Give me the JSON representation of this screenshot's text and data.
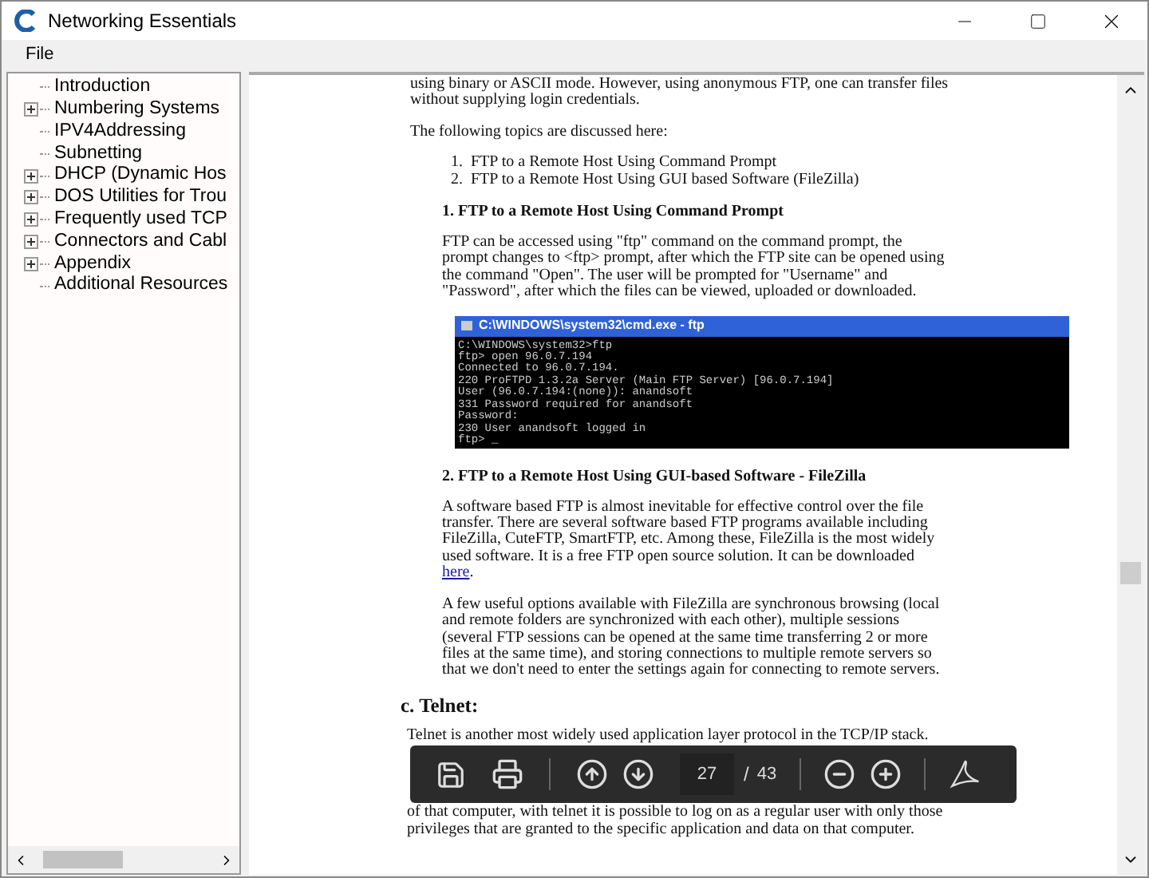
{
  "window": {
    "title": "Networking Essentials"
  },
  "menu": [
    "File"
  ],
  "tree": [
    {
      "label": "Introduction",
      "expandable": false
    },
    {
      "label": "Numbering Systems",
      "expandable": true
    },
    {
      "label": "IPV4Addressing",
      "expandable": false
    },
    {
      "label": "Subnetting",
      "expandable": false
    },
    {
      "label": "DHCP (Dynamic Hos",
      "expandable": true
    },
    {
      "label": "DOS Utilities for Trou",
      "expandable": true
    },
    {
      "label": "Frequently used TCP",
      "expandable": true
    },
    {
      "label": "Connectors and Cabl",
      "expandable": true
    },
    {
      "label": "Appendix",
      "expandable": true
    },
    {
      "label": "Additional Resources",
      "expandable": false
    }
  ],
  "document": [
    {
      "kind": "para",
      "indent": false,
      "text": "using binary or ASCII mode. However, using anonymous FTP, one can transfer files without supplying login credentials."
    },
    {
      "kind": "para",
      "indent": false,
      "text": "The following topics are discussed here:"
    },
    {
      "kind": "list",
      "items": [
        {
          "number": "1.",
          "text": "FTP to a Remote Host Using Command Prompt"
        },
        {
          "number": "2.",
          "text": "FTP to a Remote Host Using GUI based Software (FileZilla)"
        }
      ]
    },
    {
      "kind": "heading",
      "text": "1. FTP to a Remote Host Using Command Prompt"
    },
    {
      "kind": "para",
      "indent": true,
      "text": "FTP can be accessed using \"ftp\" command on the command prompt,  the prompt changes to <ftp> prompt, after which the FTP site can be opened using the command \"Open\". The user will be prompted  for \"Username\" and \"Password\", after which the files can be viewed, uploaded or downloaded."
    },
    {
      "kind": "console",
      "title": "C:\\WINDOWS\\system32\\cmd.exe - ftp",
      "lines": [
        "C:\\WINDOWS\\system32>ftp",
        "ftp> open 96.0.7.194",
        "Connected to 96.0.7.194.",
        "220 ProFTPD 1.3.2a Server (Main FTP Server) [96.0.7.194]",
        "User (96.0.7.194:(none)): anandsoft",
        "331 Password required for anandsoft",
        "Password:",
        "230 User anandsoft logged in",
        "ftp> _"
      ]
    },
    {
      "kind": "heading",
      "text": "2. FTP to a Remote Host Using GUI-based Software - FileZilla"
    },
    {
      "kind": "para",
      "indent": true,
      "text": "A software based FTP is almost inevitable for effective control over the file transfer. There are several software based FTP programs available including FileZilla, CuteFTP, SmartFTP, etc. Among these, FileZilla is the  most widely used software. It is a  free FTP open source solution. It can be downloaded ",
      "link": "here",
      "after": "."
    },
    {
      "kind": "para",
      "indent": true,
      "text": "A few useful options available with FileZilla are synchronous browsing (local and remote folders are synchronized with each other), multiple sessions (several FTP sessions can be opened at the same time transferring 2 or more files at the same time), and storing connections to multiple remote servers so that we don't need to enter the settings again for connecting to remote servers."
    },
    {
      "kind": "section",
      "text": "c. Telnet:"
    },
    {
      "kind": "lines",
      "lines": [
        "Telnet is another most widely used application layer protocol in the TCP/IP stack.",
        "of that computer, with telnet it is possible to log on as a regular user with only those",
        "privileges that are granted to the specific application and data on that computer."
      ]
    }
  ],
  "toolbar": {
    "page": "27",
    "separator": "/",
    "total": "43"
  }
}
